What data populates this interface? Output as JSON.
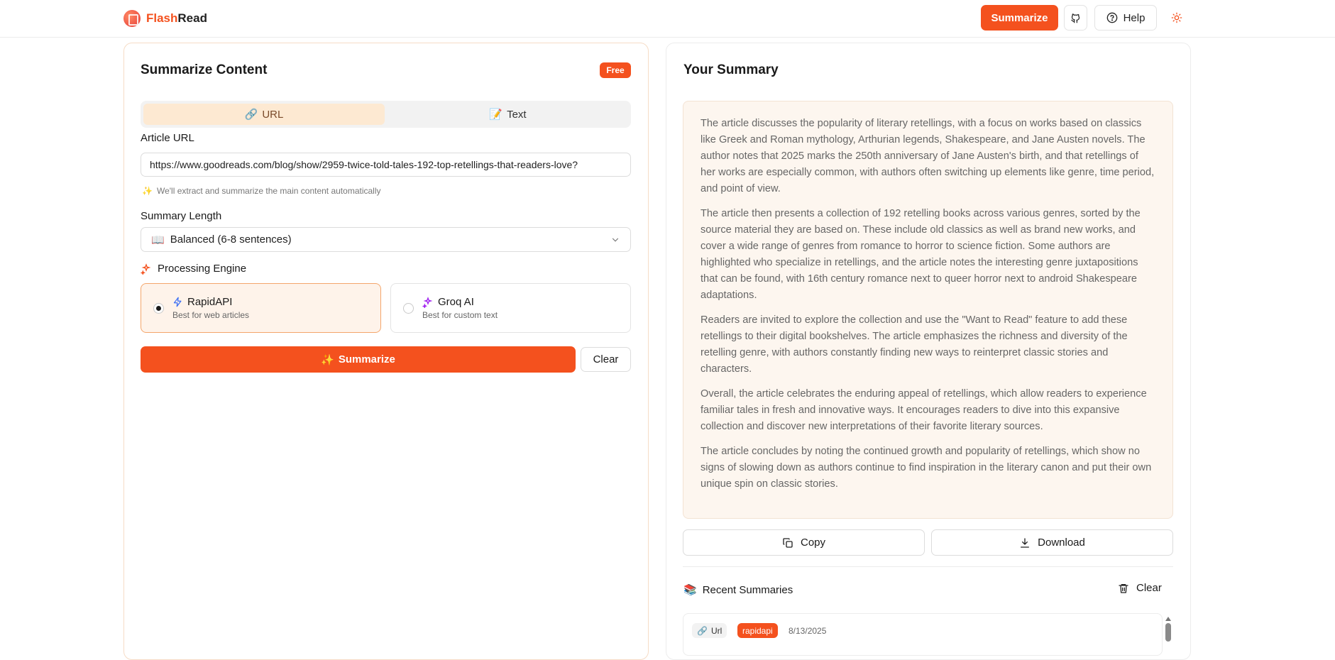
{
  "header": {
    "brand_part1": "Flash",
    "brand_part2": "Read",
    "summarize_button": "Summarize",
    "help_button": "Help"
  },
  "left": {
    "title": "Summarize Content",
    "badge": "Free",
    "tabs": [
      {
        "icon": "🔗",
        "label": "URL",
        "active": true
      },
      {
        "icon": "📝",
        "label": "Text",
        "active": false
      }
    ],
    "article_url_label": "Article URL",
    "article_url_value": "https://www.goodreads.com/blog/show/2959-twice-told-tales-192-top-retellings-that-readers-love?",
    "hint_icon": "✨",
    "hint": "We'll extract and summarize the main content automatically",
    "summary_length_label": "Summary Length",
    "summary_length_icon": "📖",
    "summary_length_value": "Balanced (6-8 sentences)",
    "engine_label": "Processing Engine",
    "engines": [
      {
        "name": "RapidAPI",
        "desc": "Best for web articles",
        "selected": true
      },
      {
        "name": "Groq AI",
        "desc": "Best for custom text",
        "selected": false
      }
    ],
    "summarize_icon": "✨",
    "summarize_button": "Summarize",
    "clear_button": "Clear"
  },
  "right": {
    "title": "Your Summary",
    "paragraphs": [
      "The article discusses the popularity of literary retellings, with a focus on works based on classics like Greek and Roman mythology, Arthurian legends, Shakespeare, and Jane Austen novels. The author notes that 2025 marks the 250th anniversary of Jane Austen's birth, and that retellings of her works are especially common, with authors often switching up elements like genre, time period, and point of view.",
      "The article then presents a collection of 192 retelling books across various genres, sorted by the source material they are based on. These include old classics as well as brand new works, and cover a wide range of genres from romance to horror to science fiction. Some authors are highlighted who specialize in retellings, and the article notes the interesting genre juxtapositions that can be found, with 16th century romance next to queer horror next to android Shakespeare adaptations.",
      "Readers are invited to explore the collection and use the \"Want to Read\" feature to add these retellings to their digital bookshelves. The article emphasizes the richness and diversity of the retelling genre, with authors constantly finding new ways to reinterpret classic stories and characters.",
      "Overall, the article celebrates the enduring appeal of retellings, which allow readers to experience familiar tales in fresh and innovative ways. It encourages readers to dive into this expansive collection and discover new interpretations of their favorite literary sources.",
      "The article concludes by noting the continued growth and popularity of retellings, which show no signs of slowing down as authors continue to find inspiration in the literary canon and put their own unique spin on classic stories."
    ],
    "copy_button": "Copy",
    "download_button": "Download",
    "recent_icon": "📚",
    "recent_label": "Recent Summaries",
    "recent_clear": "Clear",
    "recent_items": [
      {
        "type_icon": "🔗",
        "type": "Url",
        "engine": "rapidapi",
        "date": "8/13/2025"
      }
    ]
  },
  "colors": {
    "accent": "#f4511e",
    "summary_bg": "#fdf6ef",
    "tab_active_bg": "#fde9d2"
  }
}
